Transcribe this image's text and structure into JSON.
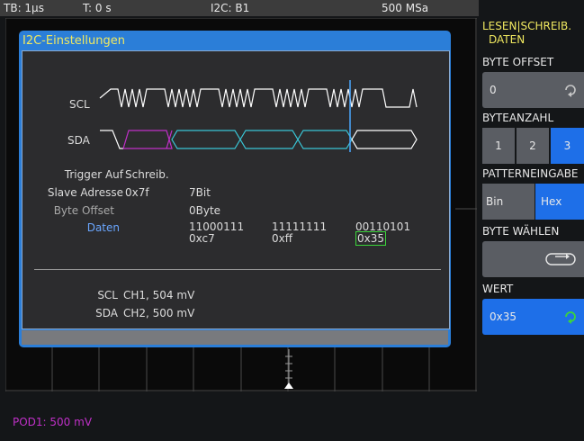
{
  "status": {
    "timebase": "TB: 1µs",
    "trigger_time": "T: 0 s",
    "bus": "I2C: B1",
    "sample_rate": "500 MSa"
  },
  "dialog": {
    "title": "I2C-Einstellungen",
    "signals": {
      "scl": "SCL",
      "sda": "SDA"
    },
    "trigger_label": "Trigger Auf",
    "trigger_value": "Schreib.",
    "slave_label": "Slave Adresse",
    "slave_value": "0x7f",
    "slave_bits": "7Bit",
    "offset_label": "Byte Offset",
    "offset_value": "0Byte",
    "data_label": "Daten",
    "bytes": [
      {
        "bin": "11000111",
        "hex": "0xc7"
      },
      {
        "bin": "11111111",
        "hex": "0xff"
      },
      {
        "bin": "00110101",
        "hex": "0x35"
      }
    ],
    "scl_source_label": "SCL",
    "scl_source": "CH1, 504 mV",
    "sda_source_label": "SDA",
    "sda_source": "CH2, 500 mV"
  },
  "menu": {
    "mode_line1": "LESEN|SCHREIB.",
    "mode_line2": "DATEN",
    "byte_offset_label": "BYTE OFFSET",
    "byte_offset_value": "0",
    "byte_count_label": "BYTEANZAHL",
    "byte_count_options": [
      "1",
      "2",
      "3"
    ],
    "byte_count_selected": "3",
    "pattern_label": "PATTERNEINGABE",
    "pattern_options": [
      "Bin",
      "Hex"
    ],
    "pattern_selected": "Hex",
    "byte_select_label": "BYTE WÄHLEN",
    "value_label": "WERT",
    "value": "0x35"
  },
  "footer": {
    "probe": "POD1: 500 mV"
  },
  "colors": {
    "dialog_border": "#2b7ed8",
    "accent_blue": "#1e6fe8",
    "selection": "#3bd53b",
    "sda_magenta": "#c030c8",
    "sda_cyan": "#39c6d6",
    "title_yellow": "#f0e860"
  },
  "icons": [
    "rotary-knob-icon",
    "toggle-arrow-icon",
    "trigger-marker-icon"
  ]
}
